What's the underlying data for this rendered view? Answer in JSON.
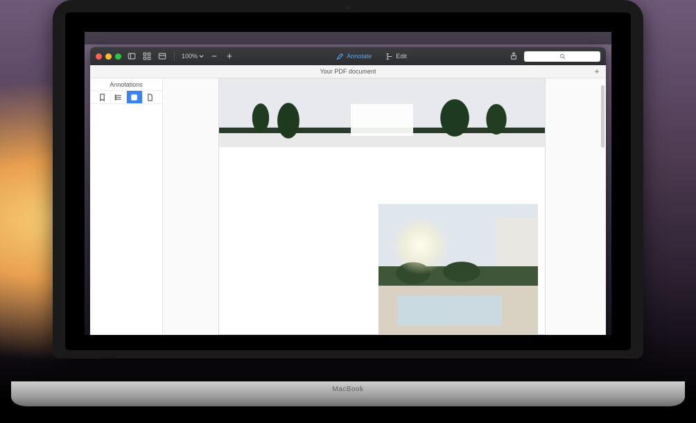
{
  "toolbar": {
    "zoom_level": "100%",
    "mode_annotate": "Annotate",
    "mode_edit": "Edit"
  },
  "tabbar": {
    "document_title": "Your PDF document"
  },
  "sidebar": {
    "title": "Annotations",
    "tabs": [
      "bookmarks",
      "outline",
      "annotations",
      "thumbnails"
    ]
  }
}
